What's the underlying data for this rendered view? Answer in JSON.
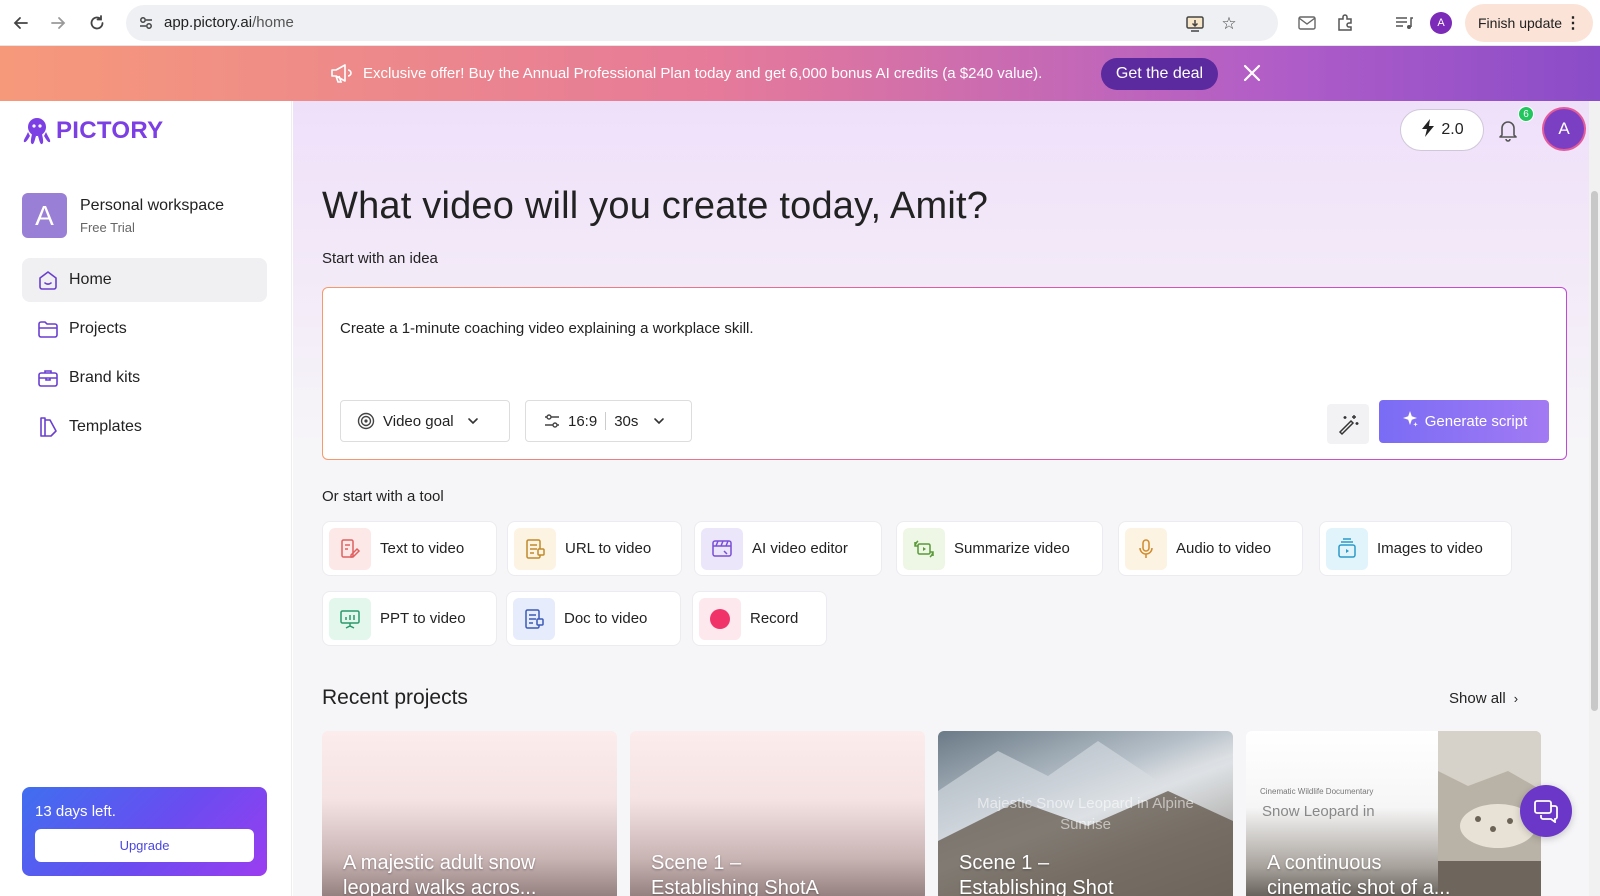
{
  "browser": {
    "url_domain": "app.pictory.ai",
    "url_path": "/home",
    "profile_initial": "A",
    "finish_update_label": "Finish update"
  },
  "promo": {
    "text": "Exclusive offer! Buy the Annual Professional Plan today and get 6,000 bonus AI credits (a $240 value).",
    "cta": "Get the deal"
  },
  "sidebar": {
    "logo_text": "PICTORY",
    "workspace": {
      "initial": "A",
      "name": "Personal workspace",
      "plan": "Free Trial"
    },
    "items": [
      {
        "label": "Home",
        "icon": "home-icon",
        "active": true
      },
      {
        "label": "Projects",
        "icon": "folder-icon",
        "active": false
      },
      {
        "label": "Brand kits",
        "icon": "briefcase-icon",
        "active": false
      },
      {
        "label": "Templates",
        "icon": "templates-icon",
        "active": false
      }
    ],
    "trial": {
      "text": "13 days left.",
      "upgrade_label": "Upgrade"
    }
  },
  "header": {
    "credits_label": "2.0",
    "notification_count": "6",
    "avatar_initial": "A"
  },
  "main": {
    "headline": "What video will you create today, Amit?",
    "idea_label": "Start with an idea",
    "prompt_value": "Create a 1-minute coaching video explaining a workplace skill.",
    "video_goal_label": "Video goal",
    "aspect_ratio": "16:9",
    "duration": "30s",
    "generate_label": "Generate script",
    "tools_label": "Or start with a tool",
    "tools": [
      {
        "label": "Text to video",
        "icon": "text-to-video-icon",
        "color": "#fde8e8"
      },
      {
        "label": "URL to video",
        "icon": "url-to-video-icon",
        "color": "#fdf3e2"
      },
      {
        "label": "AI video editor",
        "icon": "ai-video-editor-icon",
        "color": "#ece6fb"
      },
      {
        "label": "Summarize video",
        "icon": "summarize-video-icon",
        "color": "#eef7e6"
      },
      {
        "label": "Audio to video",
        "icon": "audio-to-video-icon",
        "color": "#fdf3e2"
      },
      {
        "label": "Images to video",
        "icon": "images-to-video-icon",
        "color": "#e2f4fb"
      },
      {
        "label": "PPT to video",
        "icon": "ppt-to-video-icon",
        "color": "#e3f7ec"
      },
      {
        "label": "Doc to video",
        "icon": "doc-to-video-icon",
        "color": "#e6ecfb"
      },
      {
        "label": "Record",
        "icon": "record-icon",
        "color": "#fde8ee"
      }
    ],
    "recent_title": "Recent projects",
    "show_all_label": "Show all",
    "projects": [
      {
        "title_line1": "A majestic adult snow",
        "title_line2": "leopard walks acros..."
      },
      {
        "title_line1": "Scene 1 –",
        "title_line2": "Establishing ShotA"
      },
      {
        "title_line1": "Scene 1 –",
        "title_line2": "Establishing Shot",
        "subtitle_line1": "Majestic Snow Leopard in Alpine",
        "subtitle_line2": "Sunrise"
      },
      {
        "title_line1": "A continuous",
        "title_line2": "cinematic shot of a...",
        "kicker": "Cinematic Wildlife Documentary",
        "subtitle": "Snow Leopard in"
      }
    ]
  },
  "colors": {
    "brand": "#7b3fe4",
    "promo_cta": "#5b2a9e",
    "generate": "#8a72f4",
    "badge": "#22c55e"
  }
}
